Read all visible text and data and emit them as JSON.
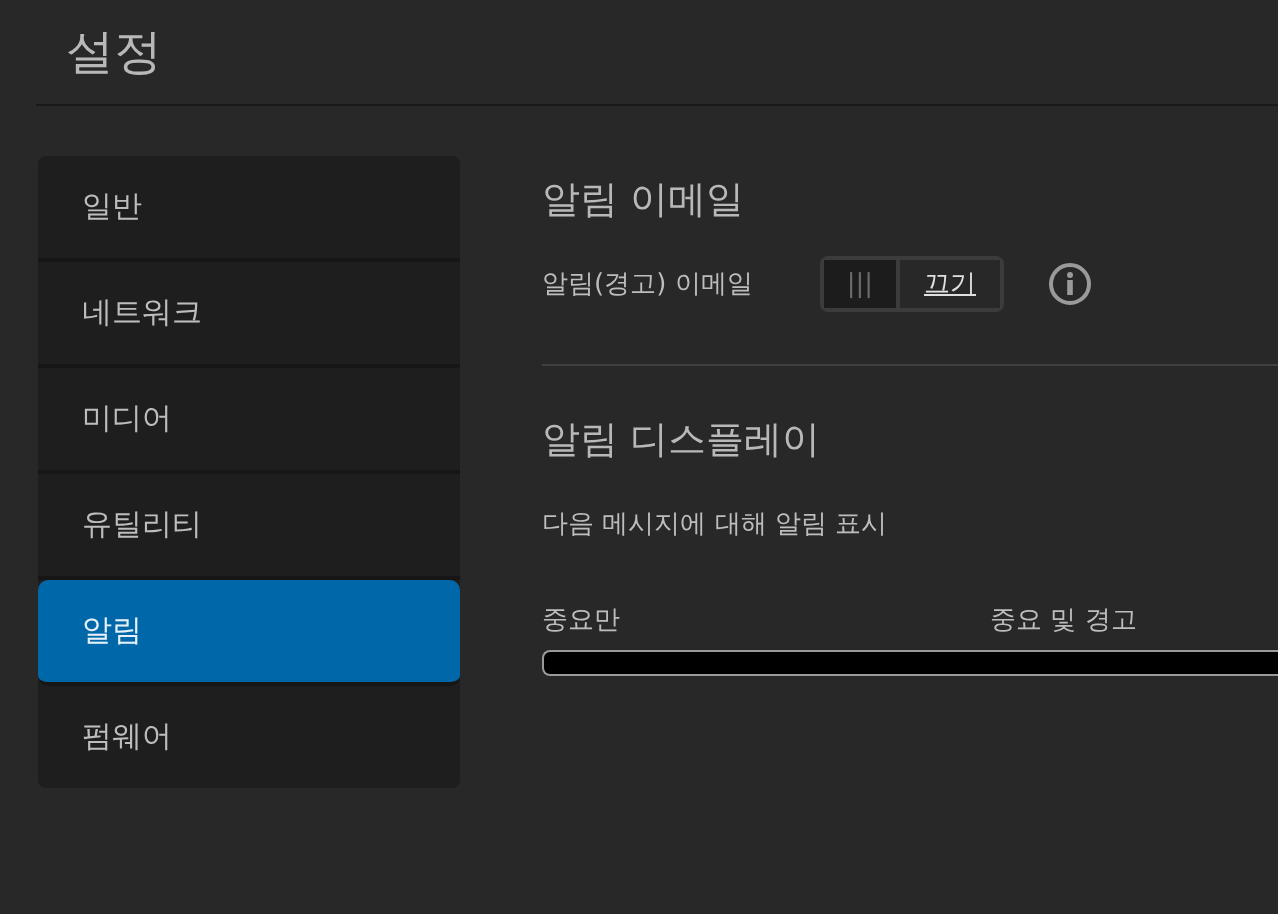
{
  "header": {
    "title": "설정"
  },
  "sidebar": {
    "items": [
      {
        "label": "일반",
        "selected": false
      },
      {
        "label": "네트워크",
        "selected": false
      },
      {
        "label": "미디어",
        "selected": false
      },
      {
        "label": "유틸리티",
        "selected": false
      },
      {
        "label": "알림",
        "selected": true
      },
      {
        "label": "펌웨어",
        "selected": false
      }
    ]
  },
  "email_section": {
    "title": "알림 이메일",
    "setting": {
      "label": "알림(경고) 이메일",
      "segments": [
        {
          "label": "|||",
          "selected": false
        },
        {
          "label": "끄기",
          "selected": true
        }
      ]
    }
  },
  "display_section": {
    "title": "알림 디스플레이",
    "description": "다음 메시지에 대해 알림 표시",
    "scale_labels": [
      "중요만",
      "중요 및 경고"
    ]
  }
}
